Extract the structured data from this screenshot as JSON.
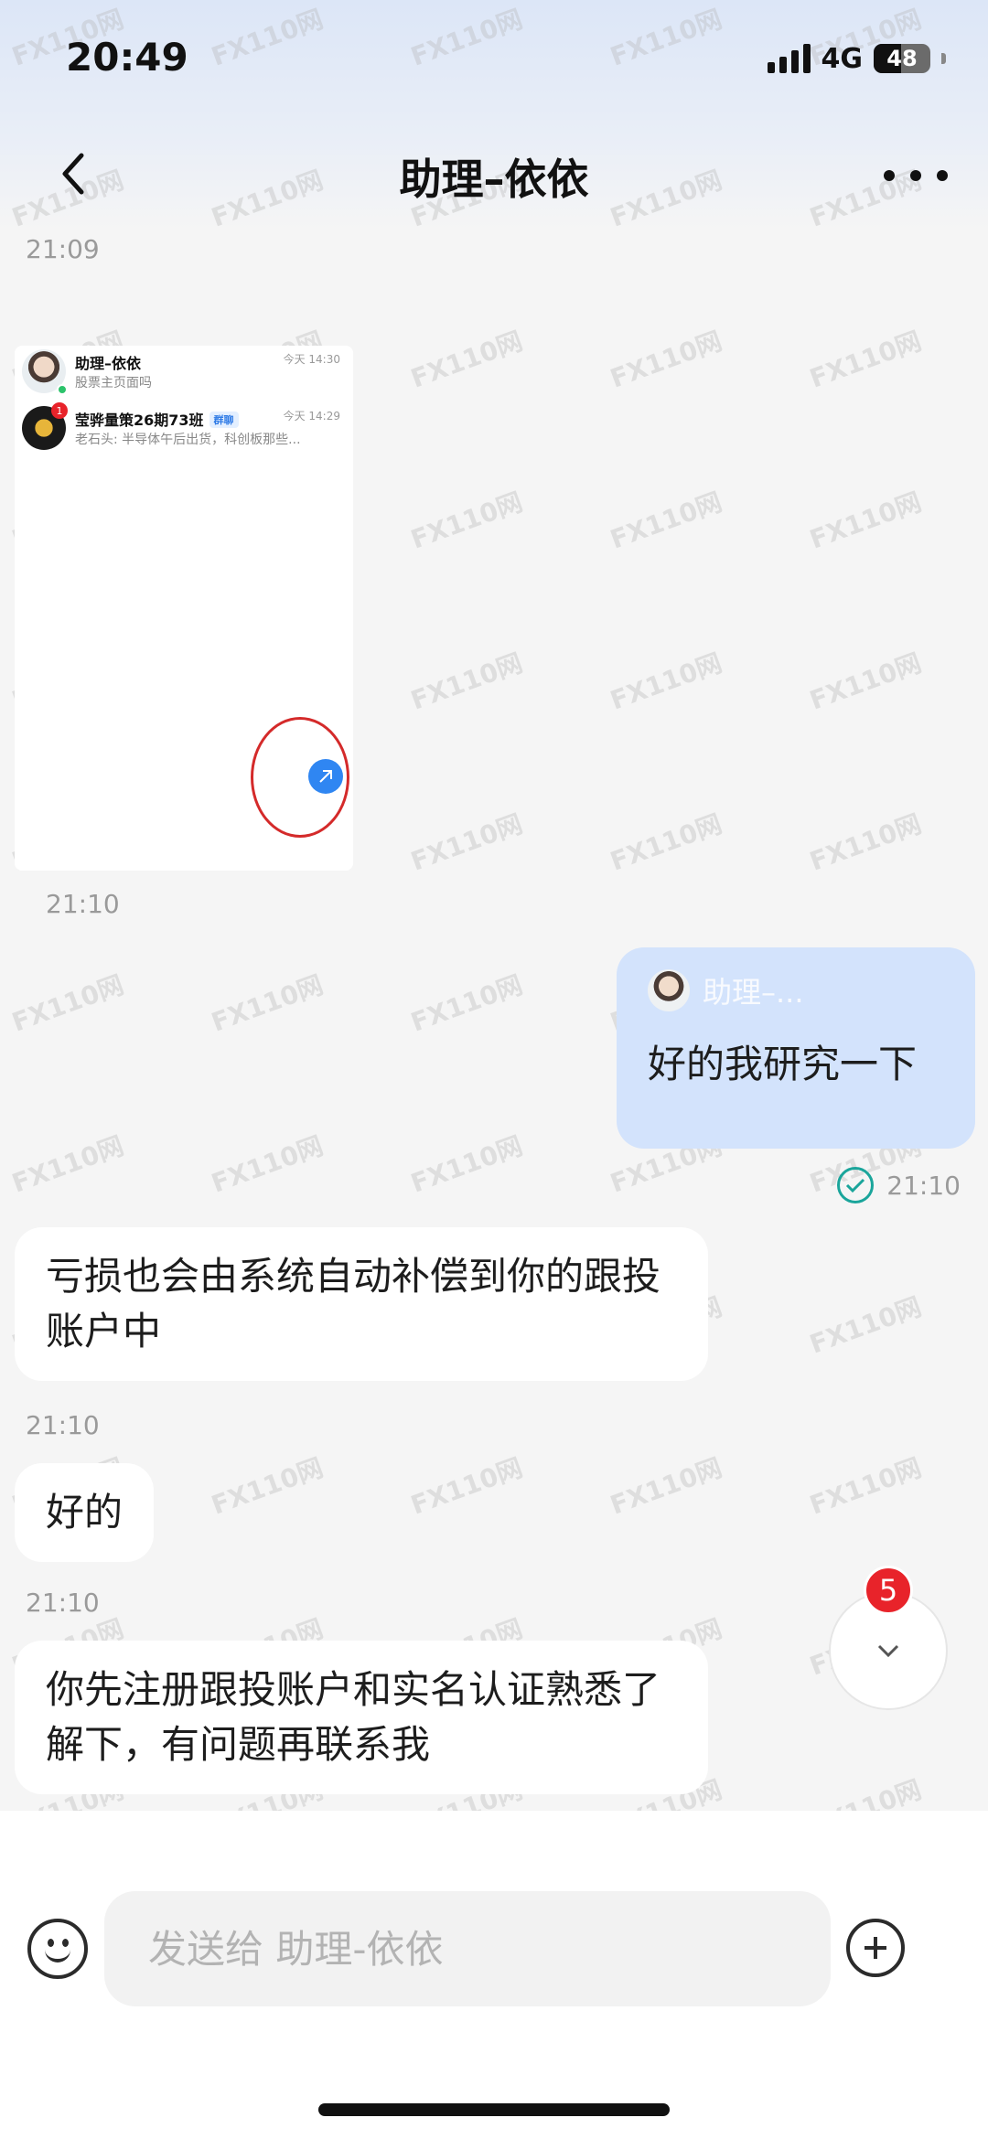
{
  "status_bar": {
    "time": "20:49",
    "network": "4G",
    "battery": "48"
  },
  "header": {
    "title": "助理–依依"
  },
  "messages": {
    "ts1": "21:09",
    "image_preview": {
      "chat1_name": "助理–依依",
      "chat1_preview": "股票主页面吗",
      "chat1_time": "今天 14:30",
      "chat2_name": "莹骅量策26期73班",
      "chat2_tag": "群聊",
      "chat2_preview": "老石头: 半导体午后出货，科创板那些...",
      "chat2_time": "今天 14:29",
      "chat2_badge": "1"
    },
    "ts2": "21:10",
    "outgoing": {
      "quote_name": "助理–...",
      "text": "好的我研究一下",
      "time": "21:10"
    },
    "in1": "亏损也会由系统自动补偿到你的跟投账户中",
    "ts3": "21:10",
    "in2": "好的",
    "ts4": "21:10",
    "in3": "你先注册跟投账户和实名认证熟悉了解下，有问题再联系我"
  },
  "scroll_down": {
    "unread_count": "5"
  },
  "input": {
    "placeholder": "发送给 助理-依依"
  },
  "watermark": "FX110网",
  "colors": {
    "accent": "#2f86f2",
    "outgoing_bubble": "#d3e3fc",
    "read_check": "#1aa59b",
    "badge": "#e8232a"
  }
}
